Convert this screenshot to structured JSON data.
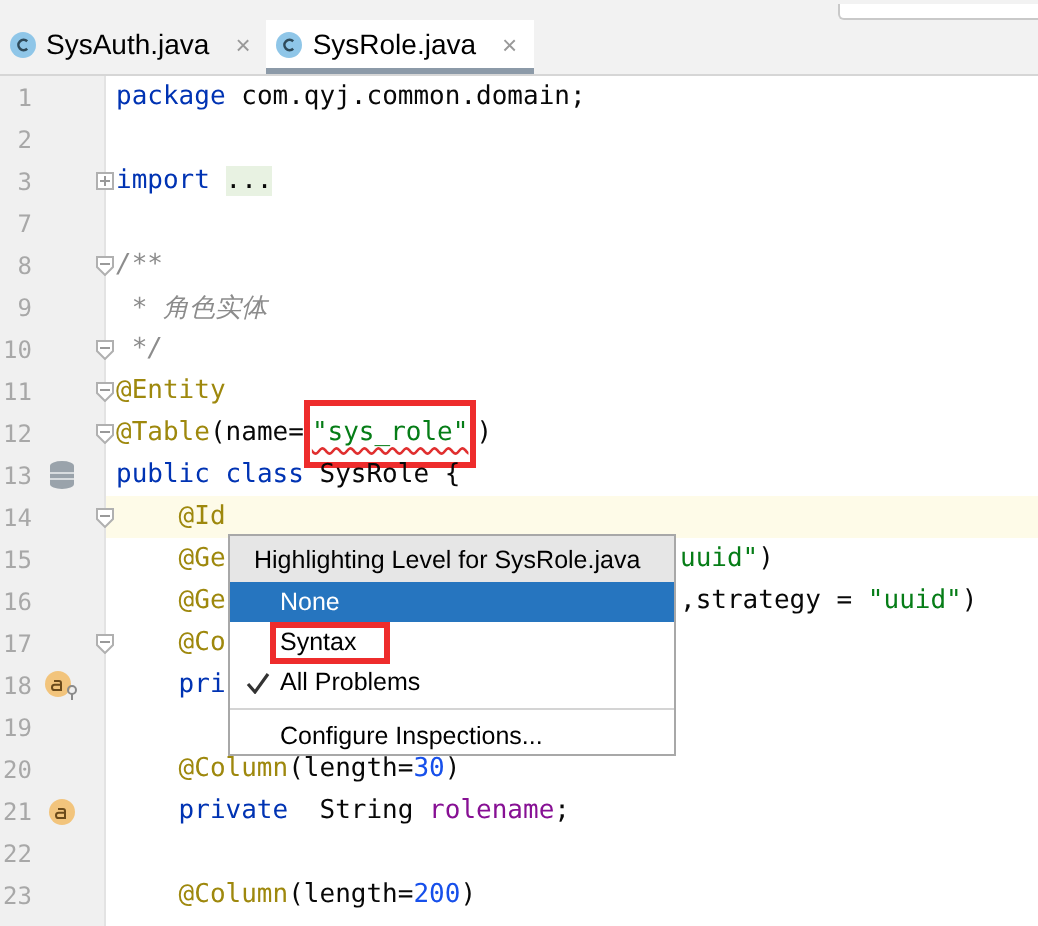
{
  "tabs": [
    {
      "label": "SysAuth.java",
      "close": "×",
      "selected": false
    },
    {
      "label": "SysRole.java",
      "close": "×",
      "selected": true
    }
  ],
  "lines": [
    {
      "number": "1",
      "tokens": [
        {
          "kind": "keyword",
          "text": "package"
        },
        {
          "kind": "plain",
          "text": " com.qyj.common.domain;"
        }
      ]
    },
    {
      "number": "2"
    },
    {
      "number": "3",
      "collapsed": true,
      "tokens": [
        {
          "kind": "keyword",
          "text": "import"
        },
        {
          "kind": "folded",
          "text": "..."
        }
      ]
    },
    {
      "number": "7"
    },
    {
      "number": "8",
      "collapsed": false,
      "tokens": [
        {
          "kind": "comment",
          "text": "/**"
        }
      ]
    },
    {
      "number": "9",
      "tokens": [
        {
          "kind": "comment",
          "text": " * 角色实体"
        }
      ]
    },
    {
      "number": "10",
      "collapsed": false,
      "tokens": [
        {
          "kind": "comment",
          "text": " */"
        }
      ]
    },
    {
      "number": "11",
      "collapsed": false,
      "tokens": [
        {
          "kind": "annotation",
          "text": "@Entity"
        }
      ]
    },
    {
      "number": "12",
      "collapsed": false,
      "tokens": [
        {
          "kind": "annotation",
          "text": "@Table"
        },
        {
          "kind": "plain",
          "text": "(name="
        },
        {
          "kind": "string",
          "text": "\"sys_role\"",
          "typo": true,
          "boxed": true
        },
        {
          "kind": "plain",
          "text": ")"
        }
      ]
    },
    {
      "number": "13",
      "gutter": {
        "kind": "database"
      },
      "tokens": [
        {
          "kind": "keyword",
          "text": "public class"
        },
        {
          "kind": "plain",
          "text": " SysRole {"
        }
      ]
    },
    {
      "number": "14",
      "collapsed": false,
      "current": true,
      "indented": true,
      "tokens": [
        {
          "kind": "annotation",
          "text": "@Id"
        }
      ]
    },
    {
      "number": "15",
      "indented": true,
      "tokens": [
        {
          "kind": "annotation",
          "text": "@Ge"
        }
      ],
      "tokens_right": [
        {
          "kind": "string",
          "text": "uuid\""
        },
        {
          "kind": "plain",
          "text": ")"
        }
      ]
    },
    {
      "number": "16",
      "indented": true,
      "tokens": [
        {
          "kind": "annotation",
          "text": "@Ge"
        }
      ],
      "tokens_right": [
        {
          "kind": "plain",
          "text": ",strategy = "
        },
        {
          "kind": "string",
          "text": "\"uuid\""
        },
        {
          "kind": "plain",
          "text": ")"
        }
      ]
    },
    {
      "number": "17",
      "collapsed": false,
      "indented": true,
      "tokens": [
        {
          "kind": "annotation",
          "text": "@Co"
        }
      ]
    },
    {
      "number": "18",
      "gutter": {
        "kind": "key-field"
      },
      "indented": true,
      "tokens": [
        {
          "kind": "keyword",
          "text": "pri"
        }
      ]
    },
    {
      "number": "19"
    },
    {
      "number": "20",
      "indented": true,
      "tokens": [
        {
          "kind": "annotation",
          "text": "@Column"
        },
        {
          "kind": "plain",
          "text": "(length="
        },
        {
          "kind": "number",
          "text": "30"
        },
        {
          "kind": "plain",
          "text": ")"
        }
      ]
    },
    {
      "number": "21",
      "gutter": {
        "kind": "field"
      },
      "indented": true,
      "tokens": [
        {
          "kind": "keyword",
          "text": "private"
        },
        {
          "kind": "plain",
          "text": "  String "
        },
        {
          "kind": "field",
          "text": "rolename"
        },
        {
          "kind": "plain",
          "text": ";"
        }
      ]
    },
    {
      "number": "22"
    },
    {
      "number": "23",
      "indented": true,
      "tokens": [
        {
          "kind": "annotation",
          "text": "@Column"
        },
        {
          "kind": "plain",
          "text": "(length="
        },
        {
          "kind": "number",
          "text": "200"
        },
        {
          "kind": "plain",
          "text": ")"
        }
      ]
    }
  ],
  "popup": {
    "title": "Highlighting Level for SysRole.java",
    "options": [
      {
        "label": "None",
        "selected": true,
        "checked": false,
        "boxed": false
      },
      {
        "label": "Syntax",
        "selected": false,
        "checked": false,
        "boxed": true
      },
      {
        "label": "All Problems",
        "selected": false,
        "checked": true,
        "boxed": false
      }
    ],
    "action": "Configure Inspections..."
  }
}
